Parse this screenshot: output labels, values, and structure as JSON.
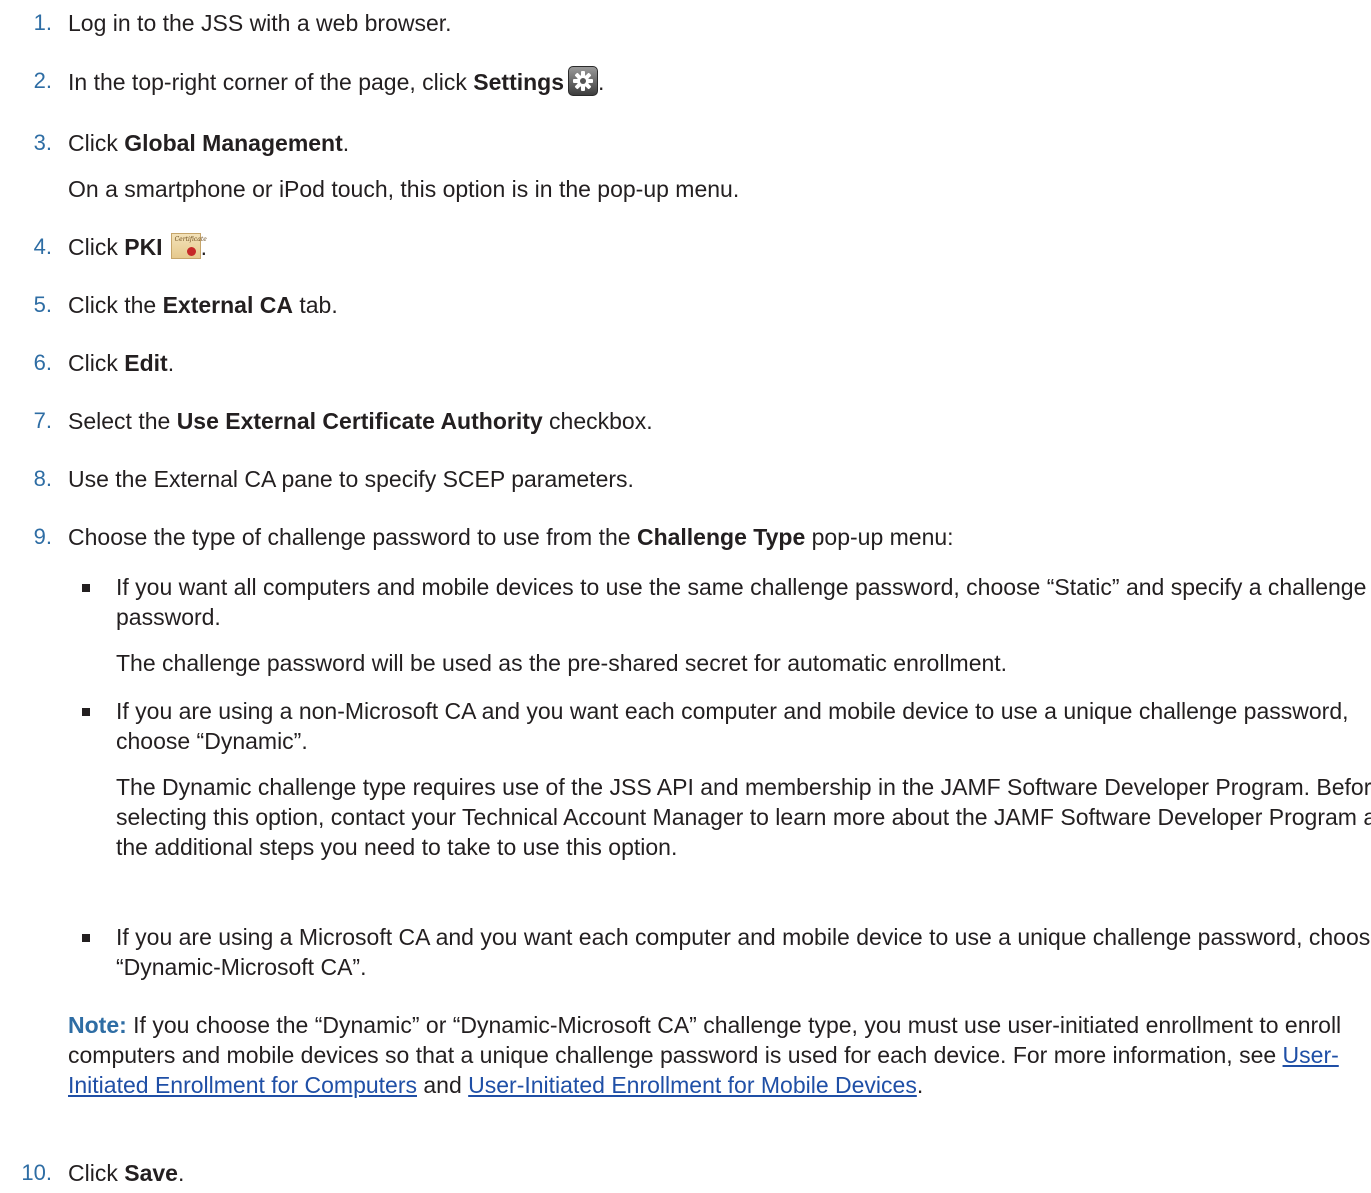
{
  "steps": [
    {
      "num": "1.",
      "text": "Log in to the JSS with a web browser."
    },
    {
      "num": "2.",
      "pre": "In the top-right corner of the page, click ",
      "bold": "Settings",
      "post": "."
    },
    {
      "num": "3.",
      "pre": "Click ",
      "bold": "Global Management",
      "post": ".",
      "sub": "On a smartphone or iPod touch, this option is in the pop-up menu."
    },
    {
      "num": "4.",
      "pre": "Click ",
      "bold": "PKI",
      "post": "."
    },
    {
      "num": "5.",
      "pre": "Click the ",
      "bold": "External CA",
      "post": " tab."
    },
    {
      "num": "6.",
      "pre": "Click ",
      "bold": "Edit",
      "post": "."
    },
    {
      "num": "7.",
      "pre": "Select the ",
      "bold": "Use External Certificate Authority",
      "post": " checkbox."
    },
    {
      "num": "8.",
      "text": "Use the External CA pane to specify SCEP parameters."
    },
    {
      "num": "9.",
      "pre": "Choose the type of challenge password to use from the ",
      "bold": "Challenge Type",
      "post": " pop-up menu:"
    },
    {
      "num": "10.",
      "pre": "Click ",
      "bold": "Save",
      "post": "."
    }
  ],
  "bullets": [
    {
      "text": "If you want all computers and mobile devices to use the same challenge password, choose “Static” and specify a challenge password.",
      "sub": "The challenge password will be used as the pre-shared secret for automatic enrollment."
    },
    {
      "text": "If you are using a non-Microsoft CA and you want each computer and mobile device to use a unique challenge password, choose “Dynamic”.",
      "sub": "The Dynamic challenge type requires use of the JSS API and membership in the JAMF Software Developer Program. Before selecting this option, contact your Technical Account Manager to learn more about the JAMF Software Developer Program and the additional steps you need to take to use this option."
    },
    {
      "text": "If you are using a Microsoft CA and you want each computer and mobile device to use a unique challenge password, choose “Dynamic-Microsoft CA”."
    }
  ],
  "note": {
    "label": "Note:",
    "text": " If you choose the “Dynamic” or “Dynamic-Microsoft CA” challenge type, you must use user-initiated enrollment to enroll computers and mobile devices so that a unique challenge password is used for each device. For more information, see ",
    "link1": "User-Initiated Enrollment for Computers",
    "mid": " and ",
    "link2": "User-Initiated Enrollment for Mobile Devices",
    "end": "."
  },
  "icons": {
    "settings": "gear-icon",
    "pki": "certificate-icon",
    "pki_script": "Certificate"
  },
  "colors": {
    "accent": "#2e6da4",
    "link": "#1f4fa6"
  }
}
